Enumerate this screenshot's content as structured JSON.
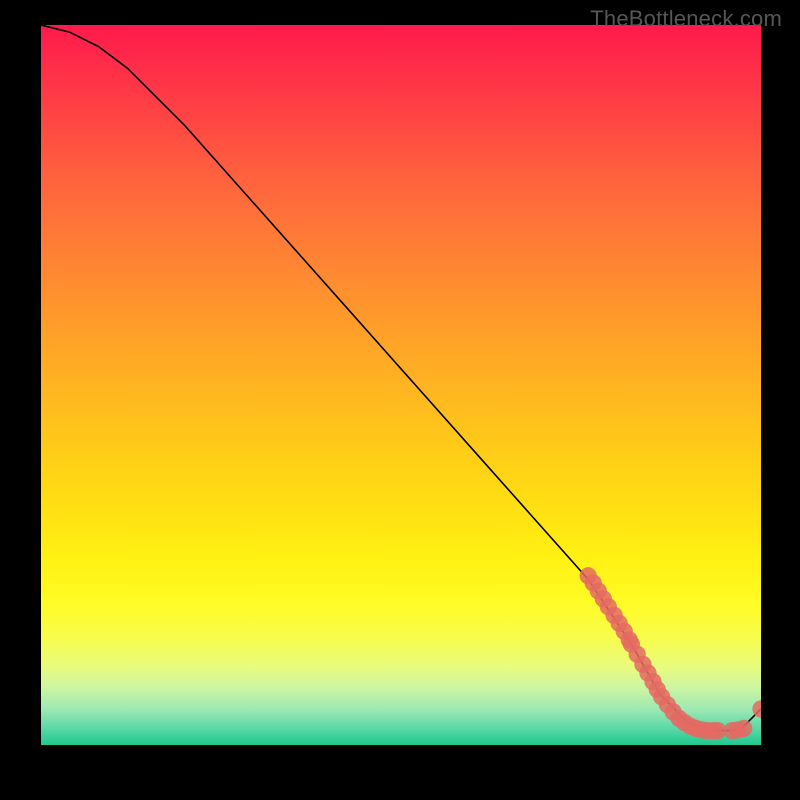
{
  "watermark": "TheBottleneck.com",
  "chart_data": {
    "type": "line",
    "title": "",
    "xlabel": "",
    "ylabel": "",
    "xlim": [
      0,
      100
    ],
    "ylim": [
      0,
      100
    ],
    "grid": false,
    "legend": false,
    "curve": {
      "x": [
        0,
        4,
        8,
        12,
        16,
        20,
        28,
        36,
        44,
        52,
        60,
        68,
        76,
        82,
        86,
        90,
        94,
        97,
        100
      ],
      "y": [
        100,
        99,
        97,
        94,
        90,
        86,
        77,
        68,
        59,
        50,
        41,
        32,
        23,
        14,
        7,
        3,
        2,
        2,
        5
      ]
    },
    "clusters": [
      {
        "cx": 76.0,
        "cy": 23.5,
        "r": 1.2
      },
      {
        "cx": 76.7,
        "cy": 22.5,
        "r": 1.2
      },
      {
        "cx": 77.4,
        "cy": 21.4,
        "r": 1.2
      },
      {
        "cx": 78.1,
        "cy": 20.3,
        "r": 1.2
      },
      {
        "cx": 78.8,
        "cy": 19.2,
        "r": 1.2
      },
      {
        "cx": 79.6,
        "cy": 18.0,
        "r": 1.2
      },
      {
        "cx": 80.3,
        "cy": 16.9,
        "r": 1.2
      },
      {
        "cx": 81.0,
        "cy": 15.8,
        "r": 1.2
      },
      {
        "cx": 81.7,
        "cy": 14.6,
        "r": 1.2
      },
      {
        "cx": 82.0,
        "cy": 14.0,
        "r": 1.2
      },
      {
        "cx": 82.8,
        "cy": 12.6,
        "r": 1.2
      },
      {
        "cx": 83.6,
        "cy": 11.2,
        "r": 1.2
      },
      {
        "cx": 84.3,
        "cy": 10.0,
        "r": 1.2
      },
      {
        "cx": 85.0,
        "cy": 8.8,
        "r": 1.2
      },
      {
        "cx": 85.6,
        "cy": 7.7,
        "r": 1.2
      },
      {
        "cx": 86.2,
        "cy": 6.7,
        "r": 1.2
      },
      {
        "cx": 87.0,
        "cy": 5.6,
        "r": 1.2
      },
      {
        "cx": 87.8,
        "cy": 4.6,
        "r": 1.2
      },
      {
        "cx": 88.6,
        "cy": 3.7,
        "r": 1.2
      },
      {
        "cx": 89.4,
        "cy": 3.1,
        "r": 1.2
      },
      {
        "cx": 90.2,
        "cy": 2.6,
        "r": 1.2
      },
      {
        "cx": 91.0,
        "cy": 2.3,
        "r": 1.2
      },
      {
        "cx": 91.8,
        "cy": 2.1,
        "r": 1.2
      },
      {
        "cx": 92.6,
        "cy": 2.0,
        "r": 1.2
      },
      {
        "cx": 93.4,
        "cy": 2.0,
        "r": 1.2
      },
      {
        "cx": 94.0,
        "cy": 2.0,
        "r": 1.2
      },
      {
        "cx": 96.0,
        "cy": 2.0,
        "r": 1.2
      },
      {
        "cx": 96.8,
        "cy": 2.1,
        "r": 1.2
      },
      {
        "cx": 97.6,
        "cy": 2.3,
        "r": 1.2
      },
      {
        "cx": 100.0,
        "cy": 5.0,
        "r": 1.2
      }
    ]
  }
}
